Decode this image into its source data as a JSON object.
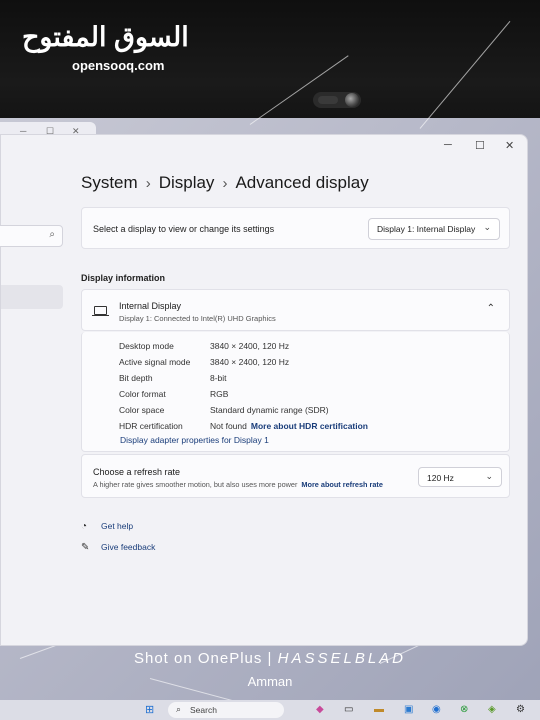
{
  "watermark": {
    "arabic": "السوق المفتوح",
    "latin": "opensooq.com"
  },
  "breadcrumb": {
    "items": [
      "System",
      "Display",
      "Advanced display"
    ],
    "separator": "›"
  },
  "window_controls": {
    "minimize": "─",
    "maximize": "☐",
    "close": "✕"
  },
  "sidebar": {
    "search_icon": "⌕"
  },
  "selector": {
    "prompt": "Select a display to view or change its settings",
    "selected": "Display 1: Internal Display",
    "chevron": "⌄"
  },
  "display_info": {
    "section_title": "Display information",
    "name": "Internal Display",
    "subtitle": "Display 1: Connected to Intel(R) UHD Graphics",
    "collapse_icon": "⌃",
    "rows": [
      {
        "label": "Desktop mode",
        "value": "3840 × 2400, 120 Hz"
      },
      {
        "label": "Active signal mode",
        "value": "3840 × 2400, 120 Hz"
      },
      {
        "label": "Bit depth",
        "value": "8-bit"
      },
      {
        "label": "Color format",
        "value": "RGB"
      },
      {
        "label": "Color space",
        "value": "Standard dynamic range (SDR)"
      },
      {
        "label": "HDR certification",
        "value": "Not found",
        "link": "More about HDR certification"
      }
    ],
    "adapter_link": "Display adapter properties for Display 1"
  },
  "refresh": {
    "title": "Choose a refresh rate",
    "description": "A higher rate gives smoother motion, but also uses more power",
    "link": "More about refresh rate",
    "selected": "120 Hz"
  },
  "footer_links": {
    "help": "Get help",
    "feedback": "Give feedback"
  },
  "photo_caption": {
    "brand": "Shot on OnePlus | ",
    "partner": "HASSELBLAD",
    "location": "Amman"
  },
  "taskbar": {
    "search_placeholder": "Search",
    "search_icon": "⌕",
    "start_icon": "⊞"
  },
  "colors": {
    "link": "#1a3d7a",
    "window_bg": "#f2f2f6",
    "card_bg": "#fbfbfd"
  }
}
